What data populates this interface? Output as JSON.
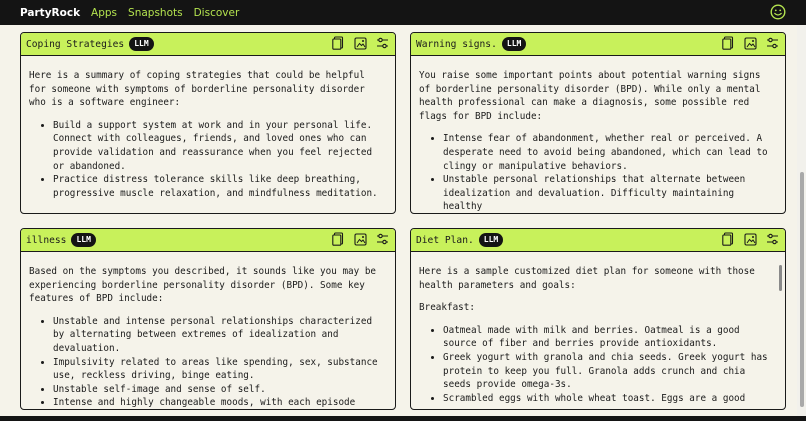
{
  "nav": {
    "brand": "PartyRock",
    "links": [
      "Apps",
      "Snapshots",
      "Discover"
    ]
  },
  "colors": {
    "accent": "#c8f15b",
    "topbar": "#141414",
    "nav_link": "#b4e34f",
    "card_bg": "#f5f3ea"
  },
  "cards": [
    {
      "title": "Coping Strategies",
      "badge": "LLM",
      "intro": "Here is a summary of coping strategies that could be helpful for someone with symptoms of borderline personality disorder who is a software engineer:",
      "bullets": [
        "Build a support system at work and in your personal life. Connect with colleagues, friends, and loved ones who can provide validation and reassurance when you feel rejected or abandoned.",
        "Practice distress tolerance skills like deep breathing, progressive muscle relaxation, and mindfulness meditation."
      ]
    },
    {
      "title": "Warning signs.",
      "badge": "LLM",
      "intro": "You raise some important points about potential warning signs of borderline personality disorder (BPD). While only a mental health professional can make a diagnosis, some possible red flags for BPD include:",
      "bullets": [
        "Intense fear of abandonment, whether real or perceived. A desperate need to avoid being abandoned, which can lead to clingy or manipulative behaviors.",
        "Unstable personal relationships that alternate between idealization and devaluation. Difficulty maintaining healthy"
      ]
    },
    {
      "title": "illness",
      "badge": "LLM",
      "intro": "Based on the symptoms you described, it sounds like you may be experiencing borderline personality disorder (BPD). Some key features of BPD include:",
      "bullets": [
        "Unstable and intense personal relationships characterized by alternating between extremes of idealization and devaluation.",
        "Impulsivity related to areas like spending, sex, substance use, reckless driving, binge eating.",
        "Unstable self-image and sense of self.",
        "Intense and highly changeable moods, with each episode lasting"
      ]
    },
    {
      "title": "Diet Plan.",
      "badge": "LLM",
      "intro": "Here is a sample customized diet plan for someone with those health parameters and goals:",
      "section": "Breakfast:",
      "bullets": [
        "Oatmeal made with milk and berries. Oatmeal is a good source of fiber and berries provide antioxidants.",
        "Greek yogurt with granola and chia seeds. Greek yogurt has protein to keep you full. Granola adds crunch and chia seeds provide omega-3s.",
        "Scrambled eggs with whole wheat toast. Eggs are a good"
      ]
    }
  ],
  "icons": [
    "document-icon",
    "image-icon",
    "settings-sliders-icon",
    "smiley-icon"
  ]
}
